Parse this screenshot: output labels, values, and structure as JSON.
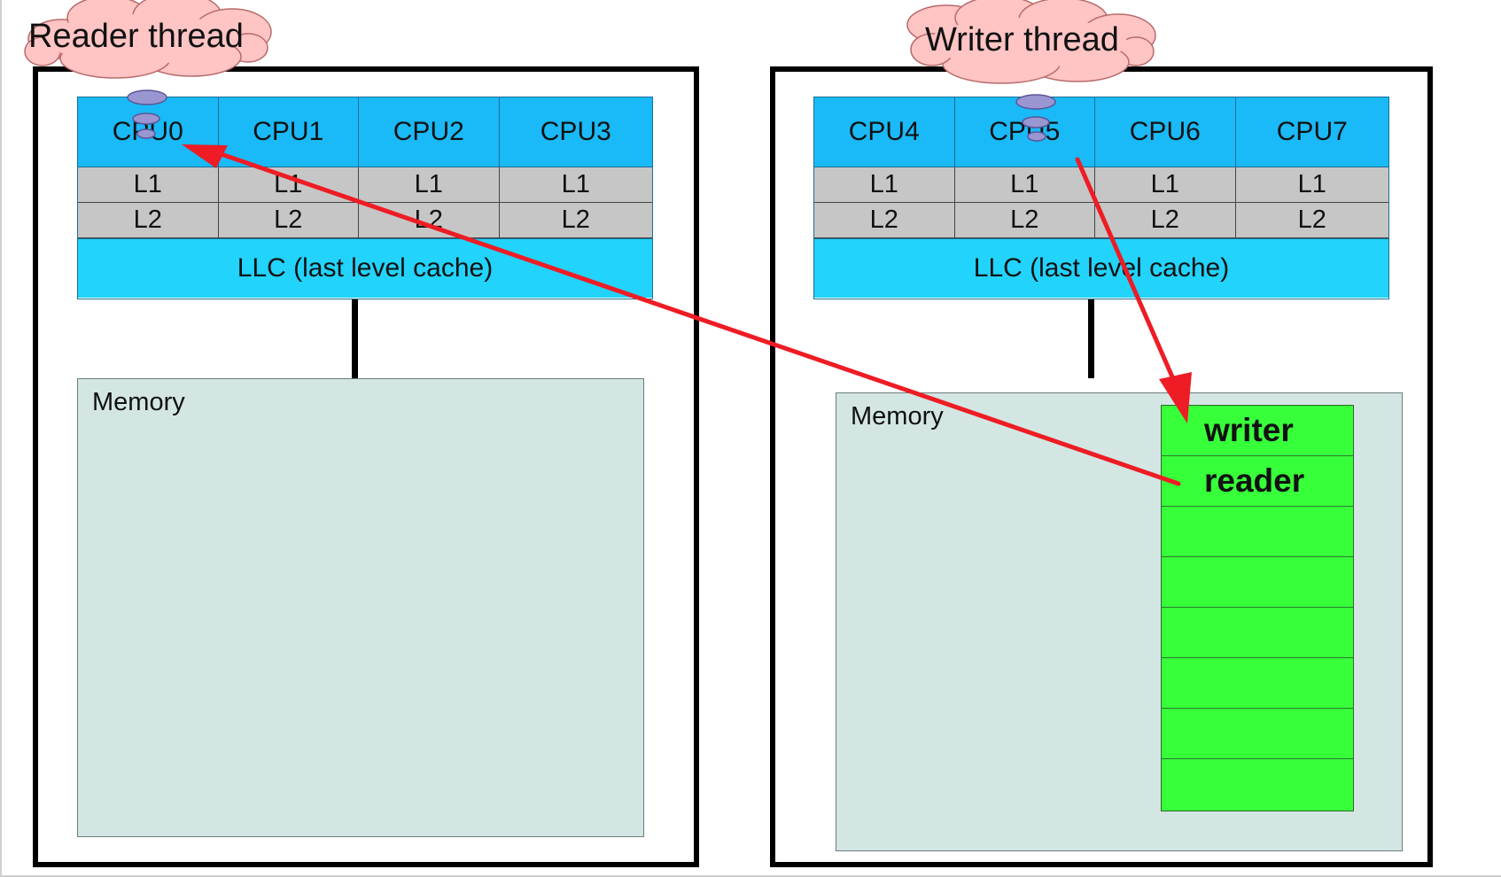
{
  "left_node": {
    "thought_label": "Reader thread",
    "cpus": [
      "CPU0",
      "CPU1",
      "CPU2",
      "CPU3"
    ],
    "l1": [
      "L1",
      "L1",
      "L1",
      "L1"
    ],
    "l2": [
      "L2",
      "L2",
      "L2",
      "L2"
    ],
    "llc": "LLC (last level cache)",
    "memory_label": "Memory"
  },
  "right_node": {
    "thought_label": "Writer thread",
    "cpus": [
      "CPU4",
      "CPU5",
      "CPU6",
      "CPU7"
    ],
    "l1": [
      "L1",
      "L1",
      "L1",
      "L1"
    ],
    "l2": [
      "L2",
      "L2",
      "L2",
      "L2"
    ],
    "llc": "LLC (last level cache)",
    "memory_label": "Memory",
    "buffer_slots": [
      "writer",
      "reader",
      "",
      "",
      "",
      "",
      "",
      ""
    ]
  },
  "colors": {
    "cpu": "#1ab9f7",
    "cache": "#c6c6c6",
    "llc": "#22d3fb",
    "memory": "#d3e6e4",
    "buffer": "#37ff3a",
    "cloud": "#ffc4c4",
    "arrow": "#ee1c24"
  }
}
